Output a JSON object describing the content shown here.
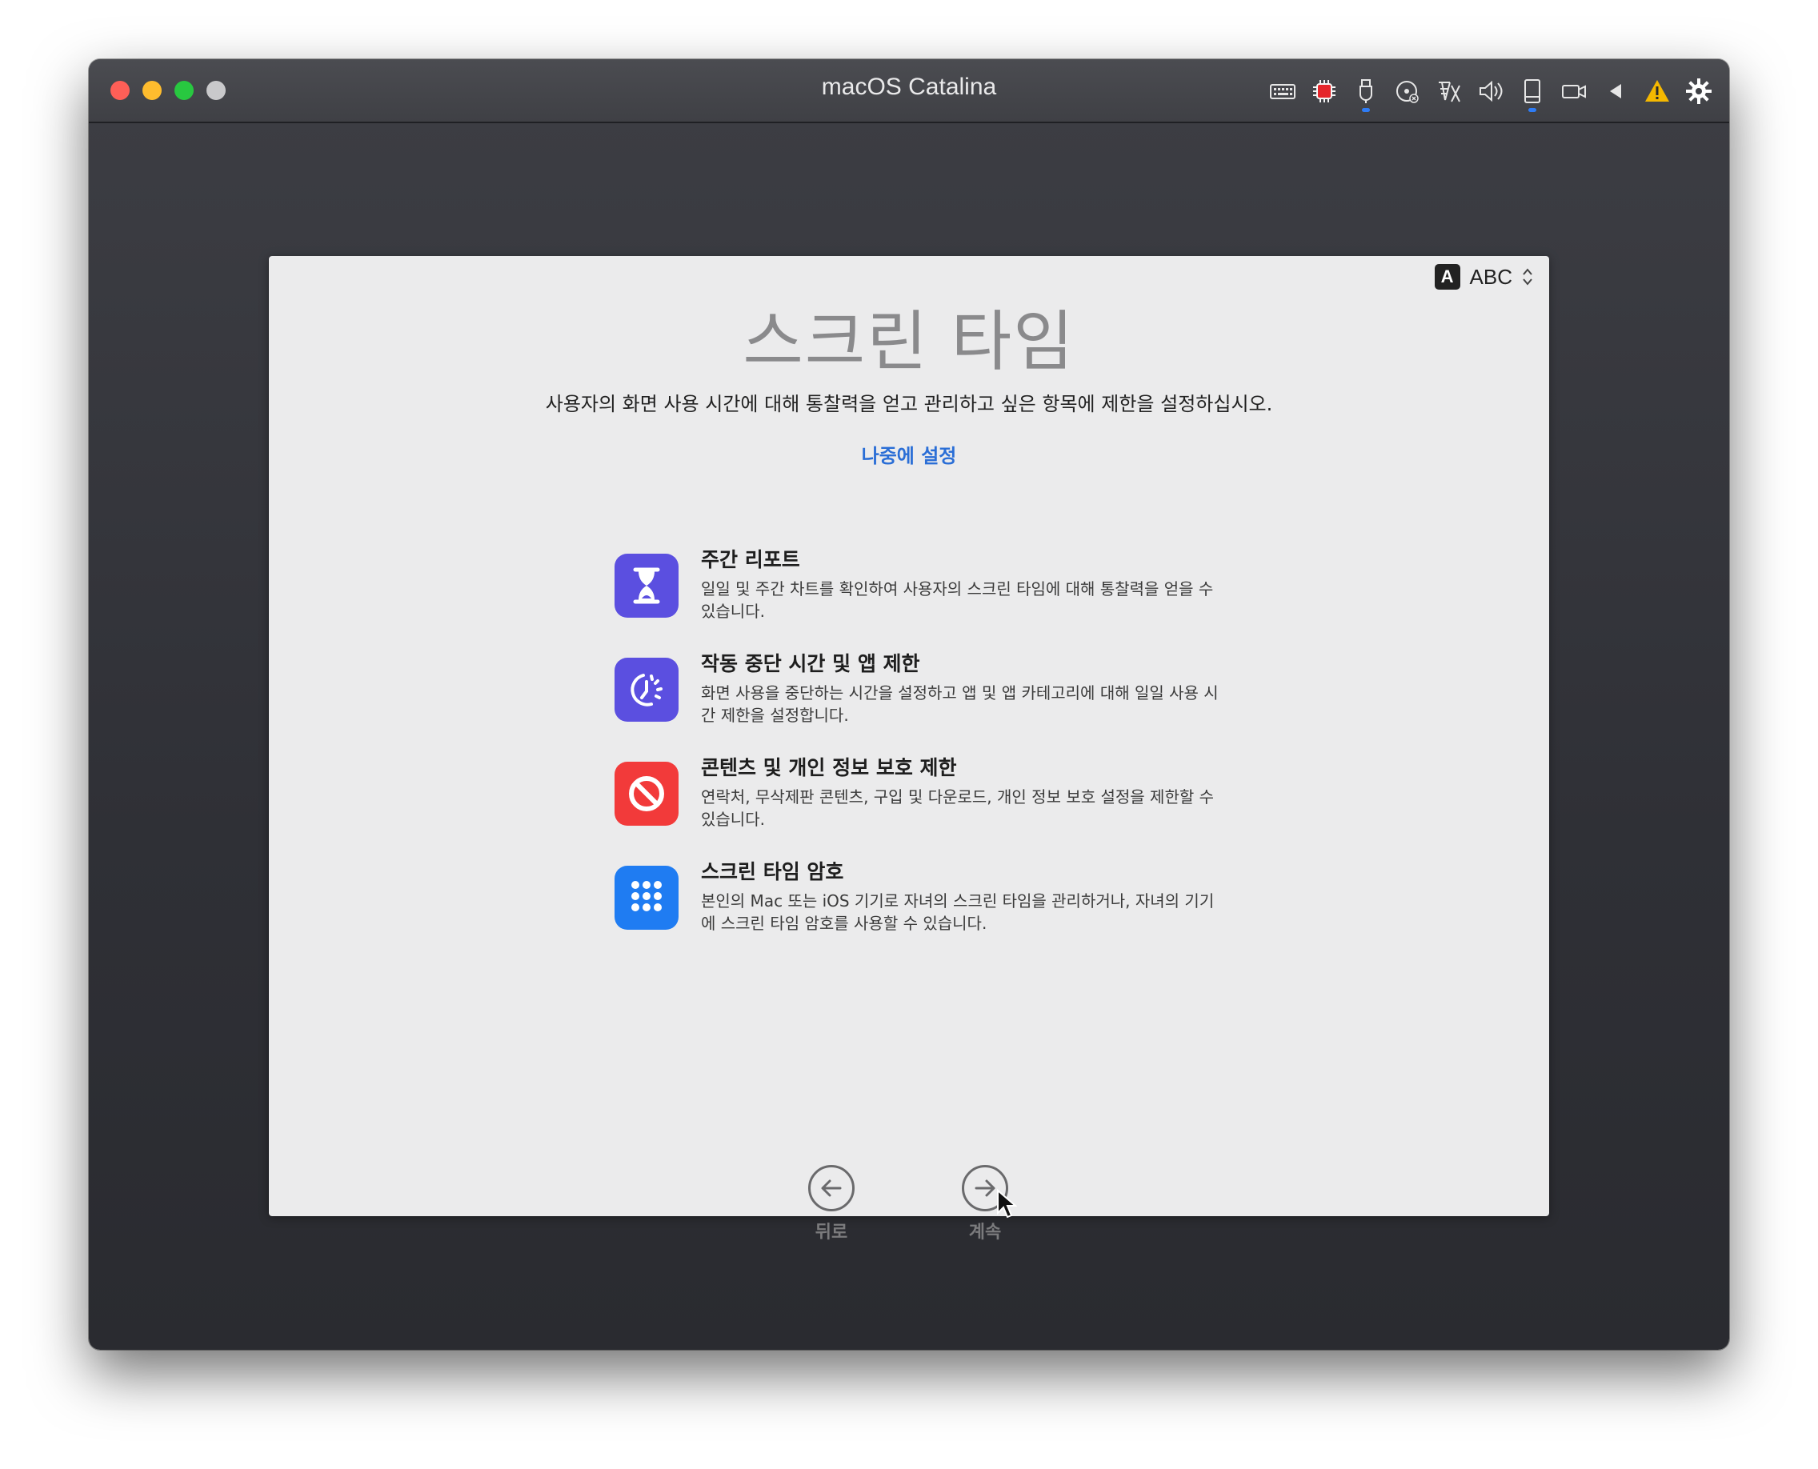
{
  "window": {
    "title": "macOS Catalina",
    "toolbar_icons": [
      "keyboard-icon",
      "cpu-icon",
      "usb-icon",
      "disk-icon",
      "network-icon",
      "volume-icon",
      "storage-icon",
      "camera-icon",
      "back-arrow-icon",
      "warning-icon",
      "gear-icon"
    ]
  },
  "input_source": {
    "badge": "A",
    "label": "ABC"
  },
  "page": {
    "title": "스크린 타임",
    "subtitle": "사용자의 화면 사용 시간에 대해 통찰력을 얻고 관리하고 싶은 항목에 제한을 설정하십시오.",
    "later_link": "나중에 설정"
  },
  "features": [
    {
      "title": "주간 리포트",
      "desc": "일일 및 주간 차트를 확인하여 사용자의 스크린 타임에 대해 통찰력을 얻을 수 있습니다.",
      "icon": "hourglass-icon",
      "color": "#5b4fe0"
    },
    {
      "title": "작동 중단 시간 및 앱 제한",
      "desc": "화면 사용을 중단하는 시간을 설정하고 앱 및 앱 카테고리에 대해 일일 사용 시간 제한을 설정합니다.",
      "icon": "downtime-icon",
      "color": "#5b4fe0"
    },
    {
      "title": "콘텐츠 및 개인 정보 보호 제한",
      "desc": "연락처, 무삭제판 콘텐츠, 구입 및 다운로드, 개인 정보 보호 설정을 제한할 수 있습니다.",
      "icon": "restriction-icon",
      "color": "#f23a3a"
    },
    {
      "title": "스크린 타임 암호",
      "desc": "본인의 Mac 또는 iOS 기기로 자녀의 스크린 타임을 관리하거나, 자녀의 기기에 스크린 타임 암호를 사용할 수 있습니다.",
      "icon": "passcode-icon",
      "color": "#1f7cf2"
    }
  ],
  "nav": {
    "back_label": "뒤로",
    "continue_label": "계속"
  }
}
